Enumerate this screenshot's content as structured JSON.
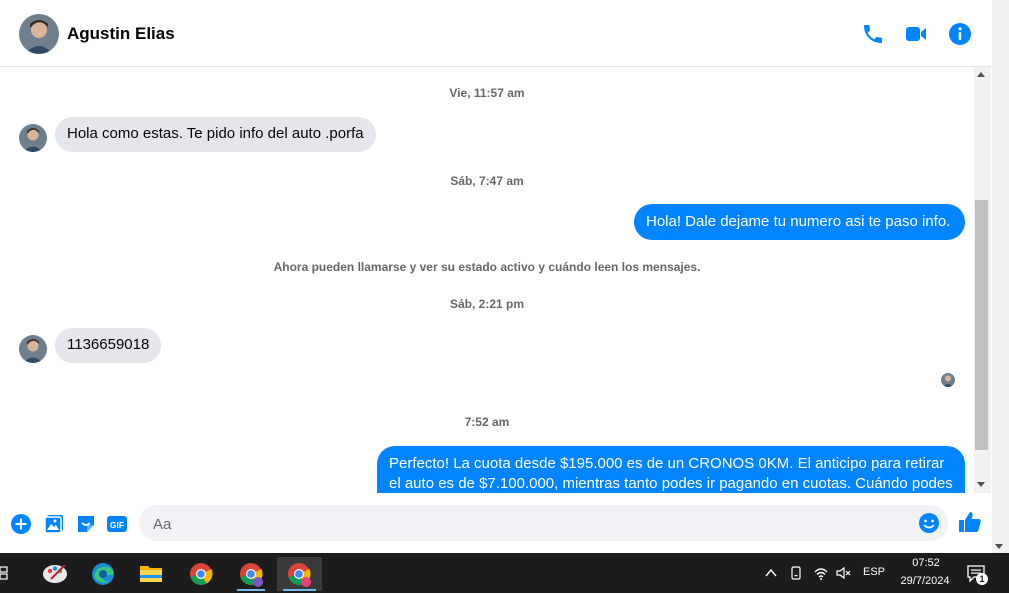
{
  "header": {
    "contact_name": "Agustin Elias"
  },
  "messages": {
    "ts1": "Vie, 11:57 am",
    "msg1": "Hola como estas. Te pido info del auto .porfa",
    "ts2": "Sáb, 7:47 am",
    "msg2": "Hola! Dale dejame tu numero  asi te paso info.",
    "notice": "Ahora pueden llamarse y ver su estado activo y cuándo leen los mensajes.",
    "ts3": "Sáb, 2:21 pm",
    "msg3": "1136659018",
    "ts4": "7:52 am",
    "msg4": "Perfecto! La cuota desde $195.000 es de un CRONOS 0KM. El anticipo para retirar el auto es de $7.100.000, mientras tanto podes ir pagando en cuotas. Cuándo podes"
  },
  "composer": {
    "placeholder": "Aa"
  },
  "taskbar": {
    "lang": "ESP",
    "time": "07:52",
    "date": "29/7/2024",
    "notification_count": "1"
  },
  "colors": {
    "accent": "#0084ff",
    "incoming_bubble": "#e4e6eb"
  }
}
